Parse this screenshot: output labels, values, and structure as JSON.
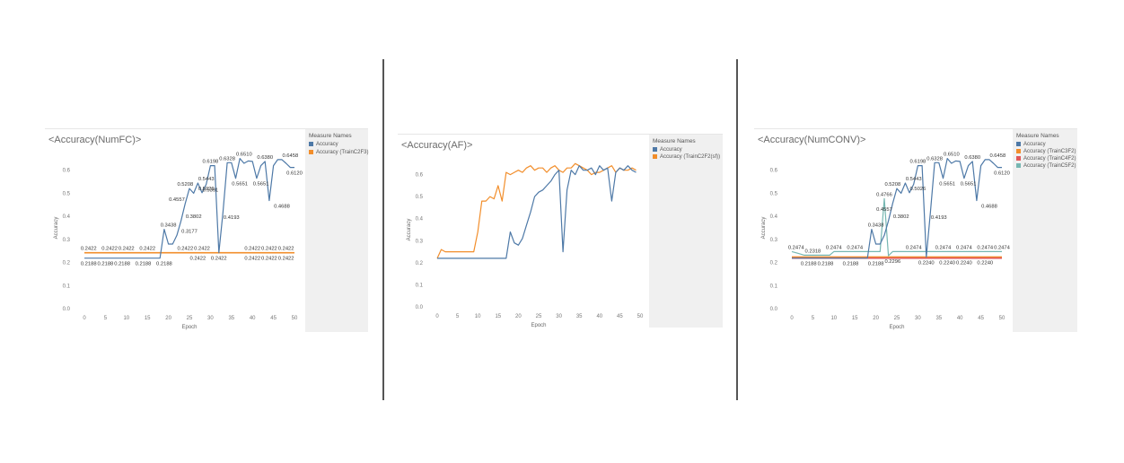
{
  "colors": {
    "Accuracy": "#4e79a7",
    "Accuracy (TrainC2F3)": "#f28e2b",
    "Accuracy (TrainC2F2(sf))": "#f28e2b",
    "Accuracy (TrainC3F2)": "#f28e2b",
    "Accuracy (TrainC4F2)": "#e15759",
    "Accuracy (TrainC5F2)": "#76b7b2"
  },
  "chart_data": [
    {
      "type": "line",
      "title": "<Accuracy(NumFC)>",
      "xlabel": "Epoch",
      "ylabel": "Accuracy",
      "xlim": [
        0,
        50
      ],
      "ylim": [
        0,
        0.7
      ],
      "xticks": [
        "0",
        "5",
        "10",
        "15",
        "20",
        "25",
        "30",
        "35",
        "40",
        "45",
        "50"
      ],
      "yticks": [
        "0.0",
        "0.1",
        "0.2",
        "0.3",
        "0.4",
        "0.5",
        "0.6"
      ],
      "legend_title": "Measure Names",
      "legend": [
        "Accuracy",
        "Accuracy (TrainC2F3)"
      ],
      "series": [
        {
          "name": "Accuracy",
          "x": [
            0,
            2,
            4,
            6,
            8,
            10,
            12,
            14,
            16,
            18,
            19,
            20,
            21,
            22,
            23,
            24,
            25,
            26,
            27,
            28,
            29,
            30,
            31,
            32,
            33,
            34,
            35,
            36,
            37,
            38,
            39,
            40,
            41,
            42,
            43,
            44,
            45,
            46,
            47,
            48,
            49,
            50
          ],
          "y": [
            0.2188,
            0.2188,
            0.2188,
            0.2188,
            0.2188,
            0.2188,
            0.2188,
            0.2188,
            0.2188,
            0.2188,
            0.3438,
            0.28,
            0.28,
            0.3177,
            0.3802,
            0.4557,
            0.5208,
            0.5,
            0.5443,
            0.5026,
            0.5391,
            0.6198,
            0.6198,
            0.2422,
            0.4193,
            0.6328,
            0.6328,
            0.5651,
            0.651,
            0.63,
            0.64,
            0.638,
            0.5651,
            0.62,
            0.638,
            0.4688,
            0.62,
            0.6458,
            0.6458,
            0.63,
            0.612,
            0.612
          ]
        },
        {
          "name": "Accuracy (TrainC2F3)",
          "x": [
            0,
            50
          ],
          "y": [
            0.2422,
            0.2422
          ]
        }
      ],
      "labels": [
        {
          "x": 1,
          "y": 0.2188,
          "t": "0.2188",
          "below": true
        },
        {
          "x": 5,
          "y": 0.2188,
          "t": "0.2188",
          "below": true
        },
        {
          "x": 9,
          "y": 0.2188,
          "t": "0.2188",
          "below": true
        },
        {
          "x": 14,
          "y": 0.2188,
          "t": "0.2188",
          "below": true
        },
        {
          "x": 19,
          "y": 0.2188,
          "t": "0.2188",
          "below": true
        },
        {
          "x": 1,
          "y": 0.2422,
          "t": "0.2422"
        },
        {
          "x": 6,
          "y": 0.2422,
          "t": "0.2422"
        },
        {
          "x": 10,
          "y": 0.2422,
          "t": "0.2422"
        },
        {
          "x": 15,
          "y": 0.2422,
          "t": "0.2422"
        },
        {
          "x": 24,
          "y": 0.2422,
          "t": "0.2422"
        },
        {
          "x": 28,
          "y": 0.2422,
          "t": "0.2422"
        },
        {
          "x": 27,
          "y": 0.2422,
          "t": "0.2422",
          "below": true
        },
        {
          "x": 32,
          "y": 0.2422,
          "t": "0.2422",
          "below": true
        },
        {
          "x": 40,
          "y": 0.2422,
          "t": "0.2422"
        },
        {
          "x": 44,
          "y": 0.2422,
          "t": "0.2422"
        },
        {
          "x": 48,
          "y": 0.2422,
          "t": "0.2422"
        },
        {
          "x": 40,
          "y": 0.2422,
          "t": "0.2422",
          "below": true
        },
        {
          "x": 44,
          "y": 0.2422,
          "t": "0.2422",
          "below": true
        },
        {
          "x": 48,
          "y": 0.2422,
          "t": "0.2422",
          "below": true
        },
        {
          "x": 20,
          "y": 0.3438,
          "t": "0.3438"
        },
        {
          "x": 25,
          "y": 0.3177,
          "t": "0.3177"
        },
        {
          "x": 26,
          "y": 0.3802,
          "t": "0.3802"
        },
        {
          "x": 22,
          "y": 0.4557,
          "t": "0.4557"
        },
        {
          "x": 24,
          "y": 0.5208,
          "t": "0.5208"
        },
        {
          "x": 29,
          "y": 0.5443,
          "t": "0.5443"
        },
        {
          "x": 29,
          "y": 0.5026,
          "t": "0.5026"
        },
        {
          "x": 30,
          "y": 0.5391,
          "t": "0.5391",
          "below": true
        },
        {
          "x": 30,
          "y": 0.6198,
          "t": "0.6198"
        },
        {
          "x": 35,
          "y": 0.4193,
          "t": "0.4193",
          "below": true
        },
        {
          "x": 34,
          "y": 0.6328,
          "t": "0.6328"
        },
        {
          "x": 37,
          "y": 0.5651,
          "t": "0.5651",
          "below": true
        },
        {
          "x": 38,
          "y": 0.651,
          "t": "0.6510"
        },
        {
          "x": 43,
          "y": 0.638,
          "t": "0.6380"
        },
        {
          "x": 42,
          "y": 0.5651,
          "t": "0.5651",
          "below": true
        },
        {
          "x": 47,
          "y": 0.4688,
          "t": "0.4688",
          "below": true
        },
        {
          "x": 49,
          "y": 0.6458,
          "t": "0.6458"
        },
        {
          "x": 50,
          "y": 0.612,
          "t": "0.6120",
          "below": true
        }
      ]
    },
    {
      "type": "line",
      "title": "<Accuracy(AF)>",
      "xlabel": "Epoch",
      "ylabel": "Accuracy",
      "xlim": [
        0,
        50
      ],
      "ylim": [
        0,
        0.7
      ],
      "xticks": [
        "0",
        "5",
        "10",
        "15",
        "20",
        "25",
        "30",
        "35",
        "40",
        "45",
        "50"
      ],
      "yticks": [
        "0.0",
        "0.1",
        "0.2",
        "0.3",
        "0.4",
        "0.5",
        "0.6"
      ],
      "legend_title": "Measure Names",
      "legend": [
        "Accuracy",
        "Accuracy (TrainC2F2(sf))"
      ],
      "series": [
        {
          "name": "Accuracy",
          "x": [
            0,
            2,
            4,
            6,
            8,
            10,
            12,
            14,
            16,
            17,
            18,
            19,
            20,
            21,
            22,
            23,
            24,
            25,
            26,
            27,
            28,
            29,
            30,
            31,
            32,
            33,
            34,
            35,
            36,
            37,
            38,
            39,
            40,
            41,
            42,
            43,
            44,
            45,
            46,
            47,
            48,
            49
          ],
          "y": [
            0.22,
            0.22,
            0.22,
            0.22,
            0.22,
            0.22,
            0.22,
            0.22,
            0.22,
            0.22,
            0.34,
            0.29,
            0.28,
            0.31,
            0.37,
            0.43,
            0.5,
            0.52,
            0.53,
            0.55,
            0.57,
            0.6,
            0.62,
            0.25,
            0.53,
            0.62,
            0.6,
            0.64,
            0.62,
            0.62,
            0.63,
            0.6,
            0.64,
            0.62,
            0.63,
            0.48,
            0.61,
            0.63,
            0.62,
            0.64,
            0.62,
            0.61
          ]
        },
        {
          "name": "Accuracy (TrainC2F2(sf))",
          "x": [
            0,
            1,
            2,
            4,
            6,
            8,
            9,
            10,
            11,
            12,
            13,
            14,
            15,
            16,
            17,
            18,
            19,
            20,
            21,
            22,
            23,
            24,
            25,
            26,
            27,
            28,
            29,
            30,
            31,
            32,
            33,
            34,
            35,
            36,
            37,
            38,
            39,
            40,
            41,
            42,
            43,
            44,
            45,
            46,
            47,
            48,
            49
          ],
          "y": [
            0.22,
            0.26,
            0.25,
            0.25,
            0.25,
            0.25,
            0.25,
            0.34,
            0.48,
            0.48,
            0.5,
            0.49,
            0.55,
            0.48,
            0.61,
            0.6,
            0.61,
            0.62,
            0.61,
            0.63,
            0.64,
            0.62,
            0.63,
            0.63,
            0.61,
            0.63,
            0.64,
            0.62,
            0.61,
            0.63,
            0.63,
            0.65,
            0.64,
            0.63,
            0.62,
            0.6,
            0.61,
            0.61,
            0.62,
            0.63,
            0.64,
            0.61,
            0.63,
            0.62,
            0.62,
            0.63,
            0.62
          ]
        }
      ],
      "labels": []
    },
    {
      "type": "line",
      "title": "<Accuracy(NumCONV)>",
      "xlabel": "Epoch",
      "ylabel": "Accuracy",
      "xlim": [
        0,
        50
      ],
      "ylim": [
        0,
        0.7
      ],
      "xticks": [
        "0",
        "5",
        "10",
        "15",
        "20",
        "25",
        "30",
        "35",
        "40",
        "45",
        "50"
      ],
      "yticks": [
        "0.0",
        "0.1",
        "0.2",
        "0.3",
        "0.4",
        "0.5",
        "0.6"
      ],
      "legend_title": "Measure Names",
      "legend": [
        "Accuracy",
        "Accuracy (TrainC3F2)",
        "Accuracy (TrainC4F2)",
        "Accuracy (TrainC5F2)"
      ],
      "series": [
        {
          "name": "Accuracy",
          "x": [
            0,
            2,
            4,
            6,
            8,
            10,
            12,
            14,
            16,
            18,
            19,
            20,
            21,
            22,
            23,
            24,
            25,
            26,
            27,
            28,
            29,
            30,
            31,
            32,
            33,
            34,
            35,
            36,
            37,
            38,
            39,
            40,
            41,
            42,
            43,
            44,
            45,
            46,
            47,
            48,
            49,
            50
          ],
          "y": [
            0.2188,
            0.2188,
            0.2188,
            0.2188,
            0.2188,
            0.2188,
            0.2188,
            0.2188,
            0.2188,
            0.2188,
            0.3438,
            0.28,
            0.28,
            0.3177,
            0.3802,
            0.4557,
            0.5208,
            0.5,
            0.5443,
            0.5026,
            0.5391,
            0.6198,
            0.6198,
            0.224,
            0.4193,
            0.6328,
            0.6328,
            0.5651,
            0.651,
            0.63,
            0.64,
            0.638,
            0.5651,
            0.62,
            0.638,
            0.4688,
            0.62,
            0.6458,
            0.6458,
            0.63,
            0.612,
            0.612
          ]
        },
        {
          "name": "Accuracy (TrainC3F2)",
          "x": [
            0,
            50
          ],
          "y": [
            0.224,
            0.224
          ]
        },
        {
          "name": "Accuracy (TrainC4F2)",
          "x": [
            0,
            50
          ],
          "y": [
            0.2188,
            0.2188
          ]
        },
        {
          "name": "Accuracy (TrainC5F2)",
          "x": [
            0,
            3,
            6,
            9,
            10,
            12,
            15,
            18,
            20,
            21,
            22,
            23,
            24,
            26,
            30,
            34,
            38,
            42,
            46,
            50
          ],
          "y": [
            0.2474,
            0.2318,
            0.2318,
            0.2318,
            0.2474,
            0.2474,
            0.2474,
            0.2474,
            0.2474,
            0.2474,
            0.4766,
            0.2296,
            0.2474,
            0.2474,
            0.2474,
            0.2474,
            0.2474,
            0.2474,
            0.2474,
            0.2474
          ]
        }
      ],
      "labels": [
        {
          "x": 1,
          "y": 0.2474,
          "t": "0.2474"
        },
        {
          "x": 5,
          "y": 0.2318,
          "t": "0.2318"
        },
        {
          "x": 10,
          "y": 0.2474,
          "t": "0.2474"
        },
        {
          "x": 15,
          "y": 0.2474,
          "t": "0.2474"
        },
        {
          "x": 4,
          "y": 0.2188,
          "t": "0.2188",
          "below": true
        },
        {
          "x": 8,
          "y": 0.2188,
          "t": "0.2188",
          "below": true
        },
        {
          "x": 14,
          "y": 0.2188,
          "t": "0.2188",
          "below": true
        },
        {
          "x": 20,
          "y": 0.2188,
          "t": "0.2188",
          "below": true
        },
        {
          "x": 24,
          "y": 0.2296,
          "t": "0.2296",
          "below": true
        },
        {
          "x": 22,
          "y": 0.4766,
          "t": "0.4766"
        },
        {
          "x": 20,
          "y": 0.3438,
          "t": "0.3438"
        },
        {
          "x": 26,
          "y": 0.3802,
          "t": "0.3802"
        },
        {
          "x": 22,
          "y": 0.4557,
          "t": "0.4557",
          "below": true
        },
        {
          "x": 24,
          "y": 0.5208,
          "t": "0.5208"
        },
        {
          "x": 29,
          "y": 0.5443,
          "t": "0.5443"
        },
        {
          "x": 30,
          "y": 0.5026,
          "t": "0.5026"
        },
        {
          "x": 30,
          "y": 0.6198,
          "t": "0.6198"
        },
        {
          "x": 35,
          "y": 0.4193,
          "t": "0.4193",
          "below": true
        },
        {
          "x": 34,
          "y": 0.6328,
          "t": "0.6328"
        },
        {
          "x": 37,
          "y": 0.5651,
          "t": "0.5651",
          "below": true
        },
        {
          "x": 38,
          "y": 0.651,
          "t": "0.6510"
        },
        {
          "x": 43,
          "y": 0.638,
          "t": "0.6380"
        },
        {
          "x": 42,
          "y": 0.5651,
          "t": "0.5651",
          "below": true
        },
        {
          "x": 47,
          "y": 0.4688,
          "t": "0.4688",
          "below": true
        },
        {
          "x": 49,
          "y": 0.6458,
          "t": "0.6458"
        },
        {
          "x": 50,
          "y": 0.612,
          "t": "0.6120",
          "below": true
        },
        {
          "x": 29,
          "y": 0.2474,
          "t": "0.2474"
        },
        {
          "x": 36,
          "y": 0.2474,
          "t": "0.2474"
        },
        {
          "x": 41,
          "y": 0.2474,
          "t": "0.2474"
        },
        {
          "x": 46,
          "y": 0.2474,
          "t": "0.2474"
        },
        {
          "x": 50,
          "y": 0.2474,
          "t": "0.2474"
        },
        {
          "x": 32,
          "y": 0.224,
          "t": "0.2240",
          "below": true
        },
        {
          "x": 37,
          "y": 0.224,
          "t": "0.2240",
          "below": true
        },
        {
          "x": 41,
          "y": 0.224,
          "t": "0.2240",
          "below": true
        },
        {
          "x": 46,
          "y": 0.224,
          "t": "0.2240",
          "below": true
        }
      ]
    }
  ]
}
